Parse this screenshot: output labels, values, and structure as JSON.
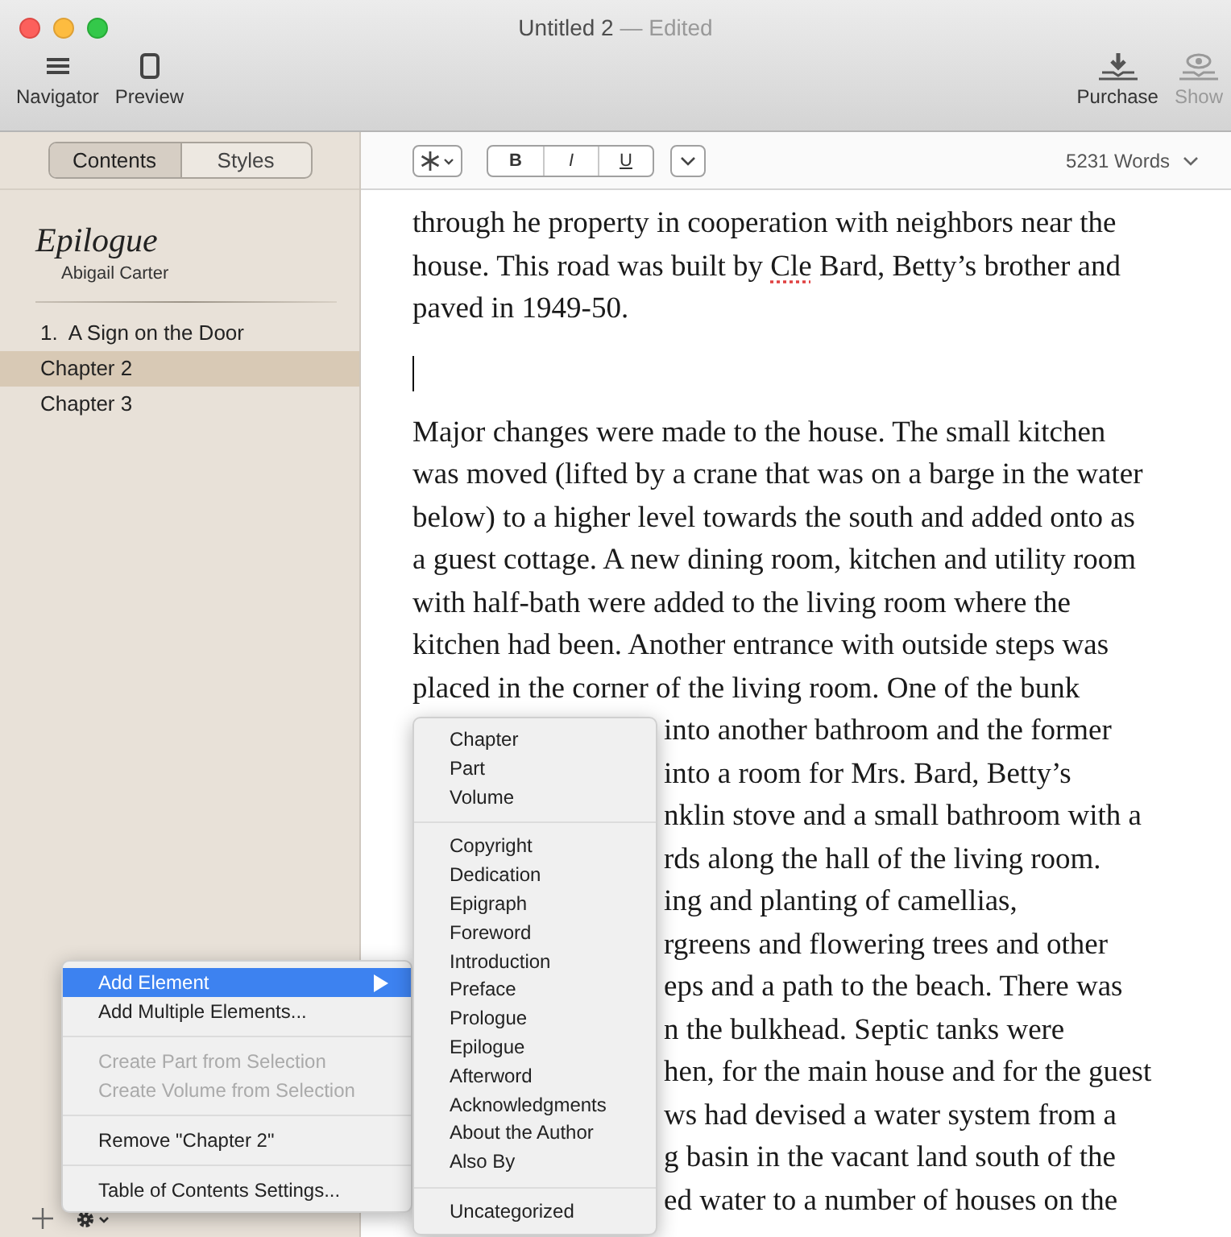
{
  "window": {
    "title": "Untitled 2",
    "title_suffix": "— Edited"
  },
  "toolbar": {
    "left": [
      {
        "kind": "navigator",
        "label": "Navigator",
        "disabled": false
      },
      {
        "kind": "preview",
        "label": "Preview",
        "disabled": false
      }
    ],
    "right": [
      {
        "kind": "purchase",
        "label": "Purchase",
        "disabled": false
      },
      {
        "kind": "show",
        "label": "Show",
        "disabled": true
      }
    ]
  },
  "sidebar": {
    "tabs": [
      {
        "label": "Contents",
        "selected": true
      },
      {
        "label": "Styles",
        "selected": false
      }
    ],
    "book_title": "Epilogue",
    "author": "Abigail Carter",
    "items": [
      {
        "number": "1.",
        "label": "A Sign on the Door",
        "selected": false
      },
      {
        "label": "Chapter 2",
        "selected": true
      },
      {
        "label": "Chapter 3",
        "selected": false
      }
    ]
  },
  "format_bar": {
    "buttons": [
      {
        "kind": "bold",
        "label": "B"
      },
      {
        "kind": "italic",
        "label": "I"
      },
      {
        "kind": "underline",
        "label": "U"
      }
    ],
    "word_count": "5231 Words"
  },
  "document": {
    "paragraphs": [
      {
        "lines": [
          [
            {
              "text": "through he property in cooperation with neighbors near the"
            }
          ],
          [
            {
              "text": "house. This road was built by "
            },
            {
              "text": "Cle",
              "misspelled": true
            },
            {
              "text": " Bard, Betty’s brother and"
            }
          ],
          [
            {
              "text": "paved in 1949-50."
            }
          ]
        ]
      },
      {
        "kind": "empty",
        "caret": true
      },
      {
        "lines": [
          [
            {
              "text": "Major changes were made to the house. The small kitchen"
            }
          ],
          [
            {
              "text": "was moved (lifted by a crane that was on a barge in the water"
            }
          ],
          [
            {
              "text": "below) to a higher level towards the south and added onto as"
            }
          ],
          [
            {
              "text": "a guest cottage. A new dining room, kitchen and utility room"
            }
          ],
          [
            {
              "text": "with half-bath were added to the living room where the"
            }
          ],
          [
            {
              "text": "kitchen had been. Another entrance with outside steps was"
            }
          ],
          [
            {
              "text": "placed in the corner of the living room. One of the bunk"
            }
          ],
          [
            {
              "text": "into another bathroom and the former",
              "covered": true
            }
          ],
          [
            {
              "text": "into a room for Mrs. Bard, Betty’s",
              "covered": true
            }
          ],
          [
            {
              "text": "nklin stove and a small bathroom with a",
              "covered": true
            }
          ],
          [
            {
              "text": "rds along the hall of the living room.",
              "covered": true
            }
          ],
          [
            {
              "text": "ing and planting of camellias,",
              "covered": true
            }
          ],
          [
            {
              "text": "rgreens and flowering trees and other",
              "covered": true
            }
          ],
          [
            {
              "text": "eps and a path to the beach. There was",
              "covered": true
            }
          ],
          [
            {
              "text": "n the bulkhead. Septic tanks were",
              "covered": true
            }
          ],
          [
            {
              "text": "hen, for the main house and for the guest",
              "covered": true
            }
          ],
          [
            {
              "text": "ws had devised a water system from a",
              "covered": true
            }
          ],
          [
            {
              "text": "g basin in the vacant land south of the",
              "covered": true
            }
          ],
          [
            {
              "text": "ed water to a number of houses on the",
              "covered": true
            }
          ]
        ]
      }
    ]
  },
  "context_menu": {
    "groups": [
      [
        {
          "label": "Add Element",
          "selected": true,
          "disabled": false,
          "submenu": true
        },
        {
          "label": "Add Multiple Elements...",
          "selected": false,
          "disabled": false,
          "submenu": false
        }
      ],
      [
        {
          "label": "Create Part from Selection",
          "selected": false,
          "disabled": true,
          "submenu": false
        },
        {
          "label": "Create Volume from Selection",
          "selected": false,
          "disabled": true,
          "submenu": false
        }
      ],
      [
        {
          "label": "Remove \"Chapter 2\"",
          "selected": false,
          "disabled": false,
          "submenu": false
        }
      ],
      [
        {
          "label": "Table of Contents Settings...",
          "selected": false,
          "disabled": false,
          "submenu": false
        }
      ]
    ]
  },
  "submenu": {
    "groups": [
      [
        "Chapter",
        "Part",
        "Volume"
      ],
      [
        "Copyright",
        "Dedication",
        "Epigraph",
        "Foreword",
        "Introduction",
        "Preface",
        "Prologue",
        "Epilogue",
        "Afterword",
        "Acknowledgments",
        "About the Author",
        "Also By"
      ],
      [
        "Uncategorized"
      ]
    ]
  }
}
